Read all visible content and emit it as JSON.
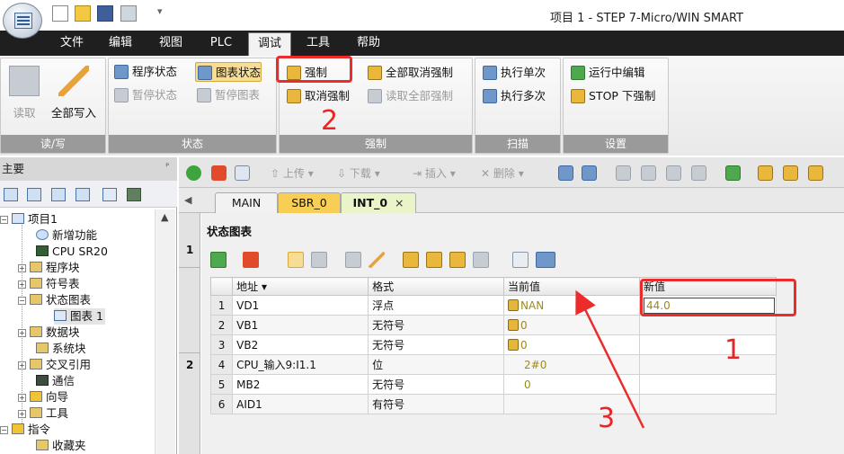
{
  "window": {
    "title": "项目 1 - STEP 7-Micro/WIN SMART"
  },
  "menu": {
    "items": [
      {
        "label": "文件"
      },
      {
        "label": "编辑"
      },
      {
        "label": "视图"
      },
      {
        "label": "PLC"
      },
      {
        "label": "调试",
        "active": true
      },
      {
        "label": "工具"
      },
      {
        "label": "帮助"
      }
    ]
  },
  "ribbon": {
    "rw": {
      "label": "读/写",
      "read": "读取",
      "write_all": "全部写入"
    },
    "status": {
      "label": "状态",
      "program_status": "程序状态",
      "chart_status": "图表状态",
      "pause_status": "暂停状态",
      "pause_chart": "暂停图表"
    },
    "force": {
      "label": "强制",
      "force": "强制",
      "unforce": "取消强制",
      "unforce_all": "全部取消强制",
      "read_all_forced": "读取全部强制"
    },
    "scan": {
      "label": "扫描",
      "single": "执行单次",
      "multiple": "执行多次"
    },
    "settings": {
      "label": "设置",
      "edit_in_run": "运行中编辑",
      "stop_download_force": "STOP 下强制"
    }
  },
  "left_pane": {
    "title": "主要",
    "tree": [
      {
        "label": "项目1"
      },
      {
        "label": "新增功能"
      },
      {
        "label": "CPU SR20"
      },
      {
        "label": "程序块"
      },
      {
        "label": "符号表"
      },
      {
        "label": "状态图表"
      },
      {
        "label": "图表 1"
      },
      {
        "label": "数据块"
      },
      {
        "label": "系统块"
      },
      {
        "label": "交叉引用"
      },
      {
        "label": "通信"
      },
      {
        "label": "向导"
      },
      {
        "label": "工具"
      },
      {
        "label": "指令"
      },
      {
        "label": "收藏夹"
      }
    ]
  },
  "editor_toolbar": {
    "upload": "上传",
    "download": "下载",
    "insert": "插入",
    "delete": "删除"
  },
  "tabs": [
    {
      "label": "MAIN"
    },
    {
      "label": "SBR_0"
    },
    {
      "label": "INT_0",
      "close": "×"
    }
  ],
  "network_numbers": [
    "1",
    "2"
  ],
  "status_chart": {
    "title": "状态图表",
    "headers": [
      "地址",
      "格式",
      "当前值",
      "新值"
    ],
    "rows": [
      {
        "n": "1",
        "address": "VD1",
        "format": "浮点",
        "current": "NAN",
        "new": "44.0"
      },
      {
        "n": "2",
        "address": "VB1",
        "format": "无符号",
        "current": "0",
        "new": ""
      },
      {
        "n": "3",
        "address": "VB2",
        "format": "无符号",
        "current": "0",
        "new": ""
      },
      {
        "n": "4",
        "address": "CPU_输入9:I1.1",
        "format": "位",
        "current": "2#0",
        "new": ""
      },
      {
        "n": "5",
        "address": "MB2",
        "format": "无符号",
        "current": "0",
        "new": ""
      },
      {
        "n": "6",
        "address": "AID1",
        "format": "有符号",
        "current": "",
        "new": ""
      }
    ]
  },
  "annotations": {
    "one": "1",
    "two": "2",
    "three": "3"
  },
  "colors": {
    "accent_red": "#ec2b2b",
    "menu_bg": "#1f1f1f",
    "value_text": "#9b8a1c"
  }
}
